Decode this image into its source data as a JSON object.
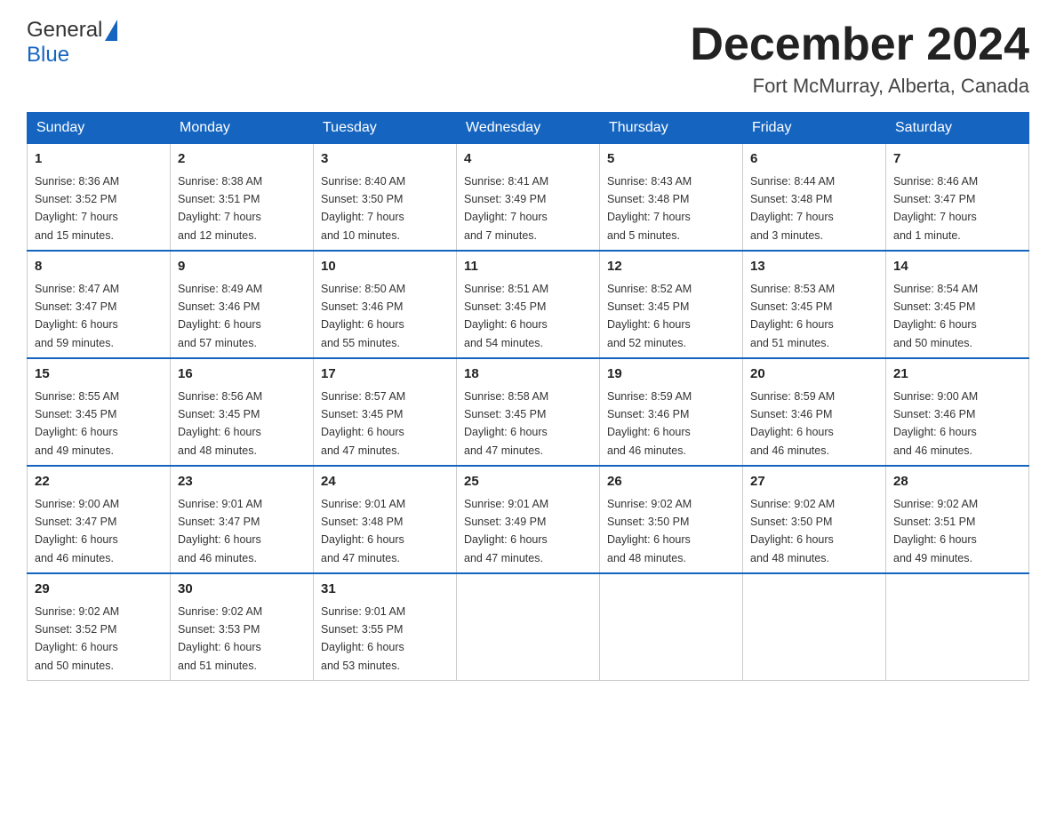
{
  "header": {
    "logo_general": "General",
    "logo_blue": "Blue",
    "title": "December 2024",
    "location": "Fort McMurray, Alberta, Canada"
  },
  "weekdays": [
    "Sunday",
    "Monday",
    "Tuesday",
    "Wednesday",
    "Thursday",
    "Friday",
    "Saturday"
  ],
  "weeks": [
    [
      {
        "day": "1",
        "sunrise": "8:36 AM",
        "sunset": "3:52 PM",
        "daylight": "7 hours and 15 minutes."
      },
      {
        "day": "2",
        "sunrise": "8:38 AM",
        "sunset": "3:51 PM",
        "daylight": "7 hours and 12 minutes."
      },
      {
        "day": "3",
        "sunrise": "8:40 AM",
        "sunset": "3:50 PM",
        "daylight": "7 hours and 10 minutes."
      },
      {
        "day": "4",
        "sunrise": "8:41 AM",
        "sunset": "3:49 PM",
        "daylight": "7 hours and 7 minutes."
      },
      {
        "day": "5",
        "sunrise": "8:43 AM",
        "sunset": "3:48 PM",
        "daylight": "7 hours and 5 minutes."
      },
      {
        "day": "6",
        "sunrise": "8:44 AM",
        "sunset": "3:48 PM",
        "daylight": "7 hours and 3 minutes."
      },
      {
        "day": "7",
        "sunrise": "8:46 AM",
        "sunset": "3:47 PM",
        "daylight": "7 hours and 1 minute."
      }
    ],
    [
      {
        "day": "8",
        "sunrise": "8:47 AM",
        "sunset": "3:47 PM",
        "daylight": "6 hours and 59 minutes."
      },
      {
        "day": "9",
        "sunrise": "8:49 AM",
        "sunset": "3:46 PM",
        "daylight": "6 hours and 57 minutes."
      },
      {
        "day": "10",
        "sunrise": "8:50 AM",
        "sunset": "3:46 PM",
        "daylight": "6 hours and 55 minutes."
      },
      {
        "day": "11",
        "sunrise": "8:51 AM",
        "sunset": "3:45 PM",
        "daylight": "6 hours and 54 minutes."
      },
      {
        "day": "12",
        "sunrise": "8:52 AM",
        "sunset": "3:45 PM",
        "daylight": "6 hours and 52 minutes."
      },
      {
        "day": "13",
        "sunrise": "8:53 AM",
        "sunset": "3:45 PM",
        "daylight": "6 hours and 51 minutes."
      },
      {
        "day": "14",
        "sunrise": "8:54 AM",
        "sunset": "3:45 PM",
        "daylight": "6 hours and 50 minutes."
      }
    ],
    [
      {
        "day": "15",
        "sunrise": "8:55 AM",
        "sunset": "3:45 PM",
        "daylight": "6 hours and 49 minutes."
      },
      {
        "day": "16",
        "sunrise": "8:56 AM",
        "sunset": "3:45 PM",
        "daylight": "6 hours and 48 minutes."
      },
      {
        "day": "17",
        "sunrise": "8:57 AM",
        "sunset": "3:45 PM",
        "daylight": "6 hours and 47 minutes."
      },
      {
        "day": "18",
        "sunrise": "8:58 AM",
        "sunset": "3:45 PM",
        "daylight": "6 hours and 47 minutes."
      },
      {
        "day": "19",
        "sunrise": "8:59 AM",
        "sunset": "3:46 PM",
        "daylight": "6 hours and 46 minutes."
      },
      {
        "day": "20",
        "sunrise": "8:59 AM",
        "sunset": "3:46 PM",
        "daylight": "6 hours and 46 minutes."
      },
      {
        "day": "21",
        "sunrise": "9:00 AM",
        "sunset": "3:46 PM",
        "daylight": "6 hours and 46 minutes."
      }
    ],
    [
      {
        "day": "22",
        "sunrise": "9:00 AM",
        "sunset": "3:47 PM",
        "daylight": "6 hours and 46 minutes."
      },
      {
        "day": "23",
        "sunrise": "9:01 AM",
        "sunset": "3:47 PM",
        "daylight": "6 hours and 46 minutes."
      },
      {
        "day": "24",
        "sunrise": "9:01 AM",
        "sunset": "3:48 PM",
        "daylight": "6 hours and 47 minutes."
      },
      {
        "day": "25",
        "sunrise": "9:01 AM",
        "sunset": "3:49 PM",
        "daylight": "6 hours and 47 minutes."
      },
      {
        "day": "26",
        "sunrise": "9:02 AM",
        "sunset": "3:50 PM",
        "daylight": "6 hours and 48 minutes."
      },
      {
        "day": "27",
        "sunrise": "9:02 AM",
        "sunset": "3:50 PM",
        "daylight": "6 hours and 48 minutes."
      },
      {
        "day": "28",
        "sunrise": "9:02 AM",
        "sunset": "3:51 PM",
        "daylight": "6 hours and 49 minutes."
      }
    ],
    [
      {
        "day": "29",
        "sunrise": "9:02 AM",
        "sunset": "3:52 PM",
        "daylight": "6 hours and 50 minutes."
      },
      {
        "day": "30",
        "sunrise": "9:02 AM",
        "sunset": "3:53 PM",
        "daylight": "6 hours and 51 minutes."
      },
      {
        "day": "31",
        "sunrise": "9:01 AM",
        "sunset": "3:55 PM",
        "daylight": "6 hours and 53 minutes."
      },
      null,
      null,
      null,
      null
    ]
  ],
  "labels": {
    "sunrise": "Sunrise:",
    "sunset": "Sunset:",
    "daylight": "Daylight:"
  }
}
